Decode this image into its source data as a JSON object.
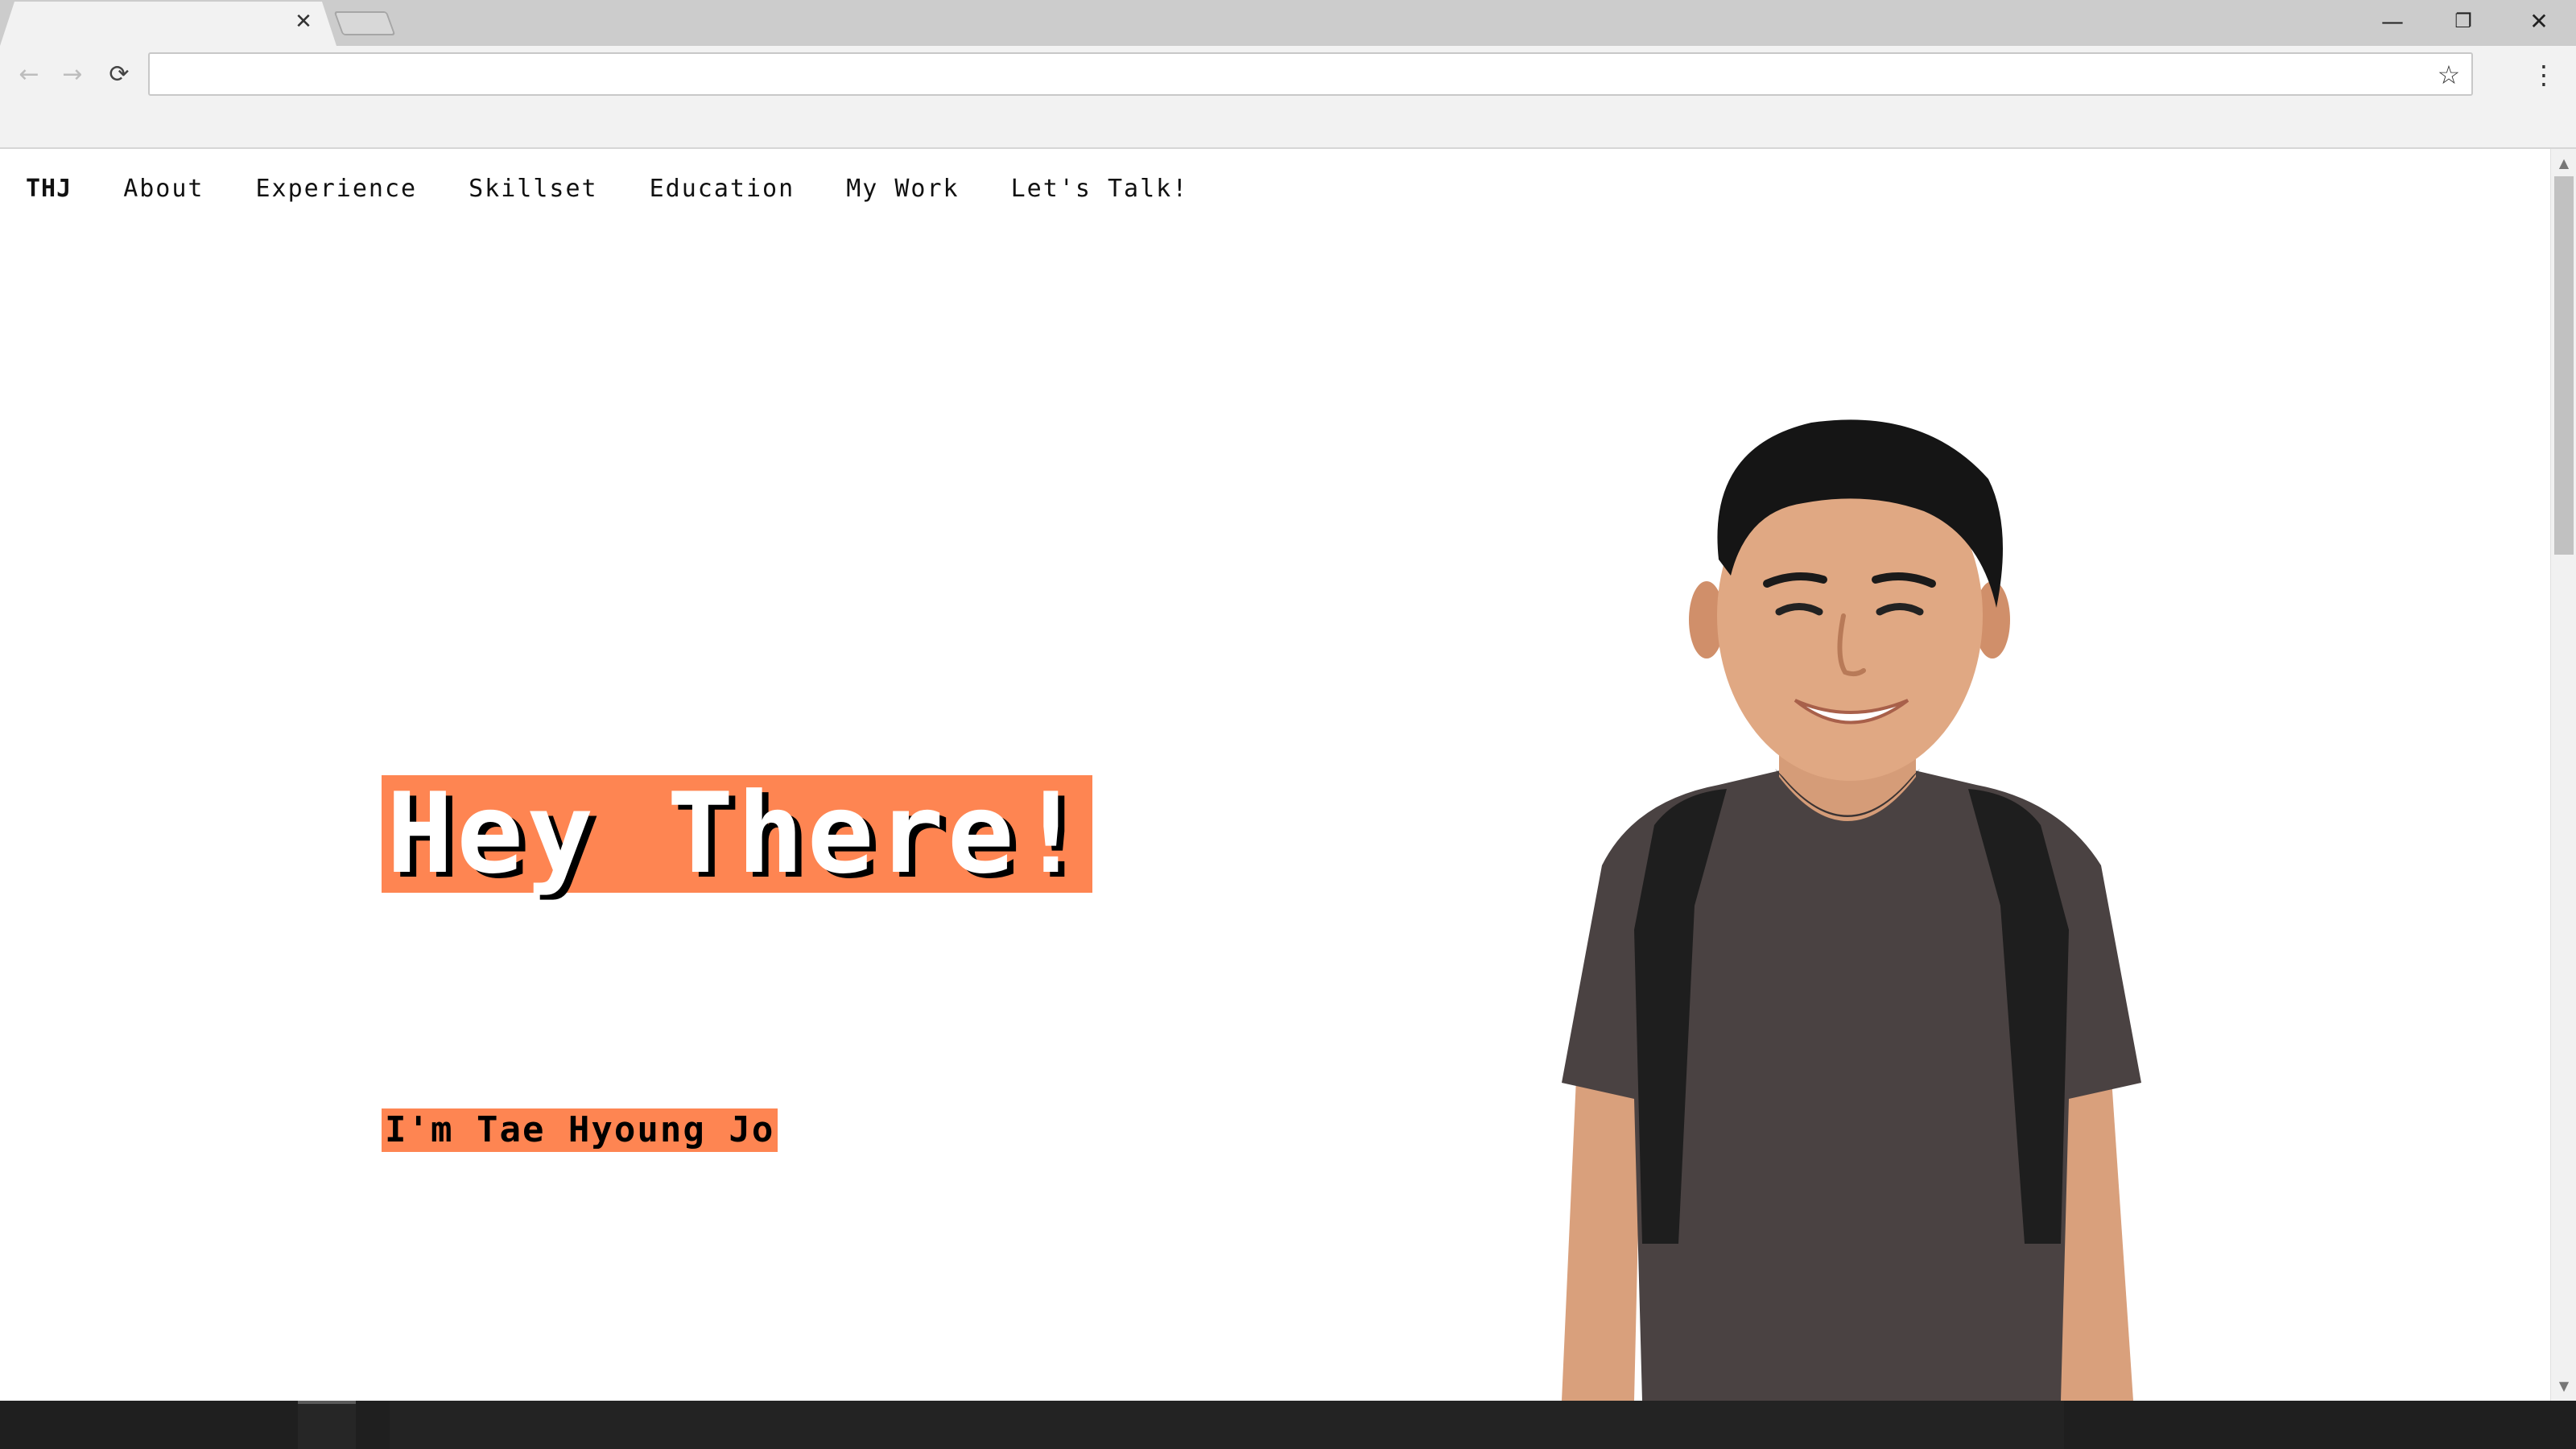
{
  "browser": {
    "tab_close_icon": "close-icon",
    "address": "",
    "window_controls": {
      "minimize": "—",
      "restore": "❐",
      "close": "✕"
    },
    "back_icon": "←",
    "forward_icon": "→",
    "reload_icon": "⟳",
    "star_icon": "☆",
    "menu_icon": "⋮",
    "tab_close_glyph": "✕"
  },
  "site": {
    "brand": "THJ",
    "nav": [
      "About",
      "Experience",
      "Skillset",
      "Education",
      "My Work",
      "Let's Talk!"
    ],
    "hero": {
      "title": "Hey There!",
      "subtitle": "I'm Tae Hyoung Jo"
    },
    "accent_color": "#fe8552"
  },
  "scrollbar": {
    "up": "▲",
    "down": "▼",
    "position": 0
  }
}
